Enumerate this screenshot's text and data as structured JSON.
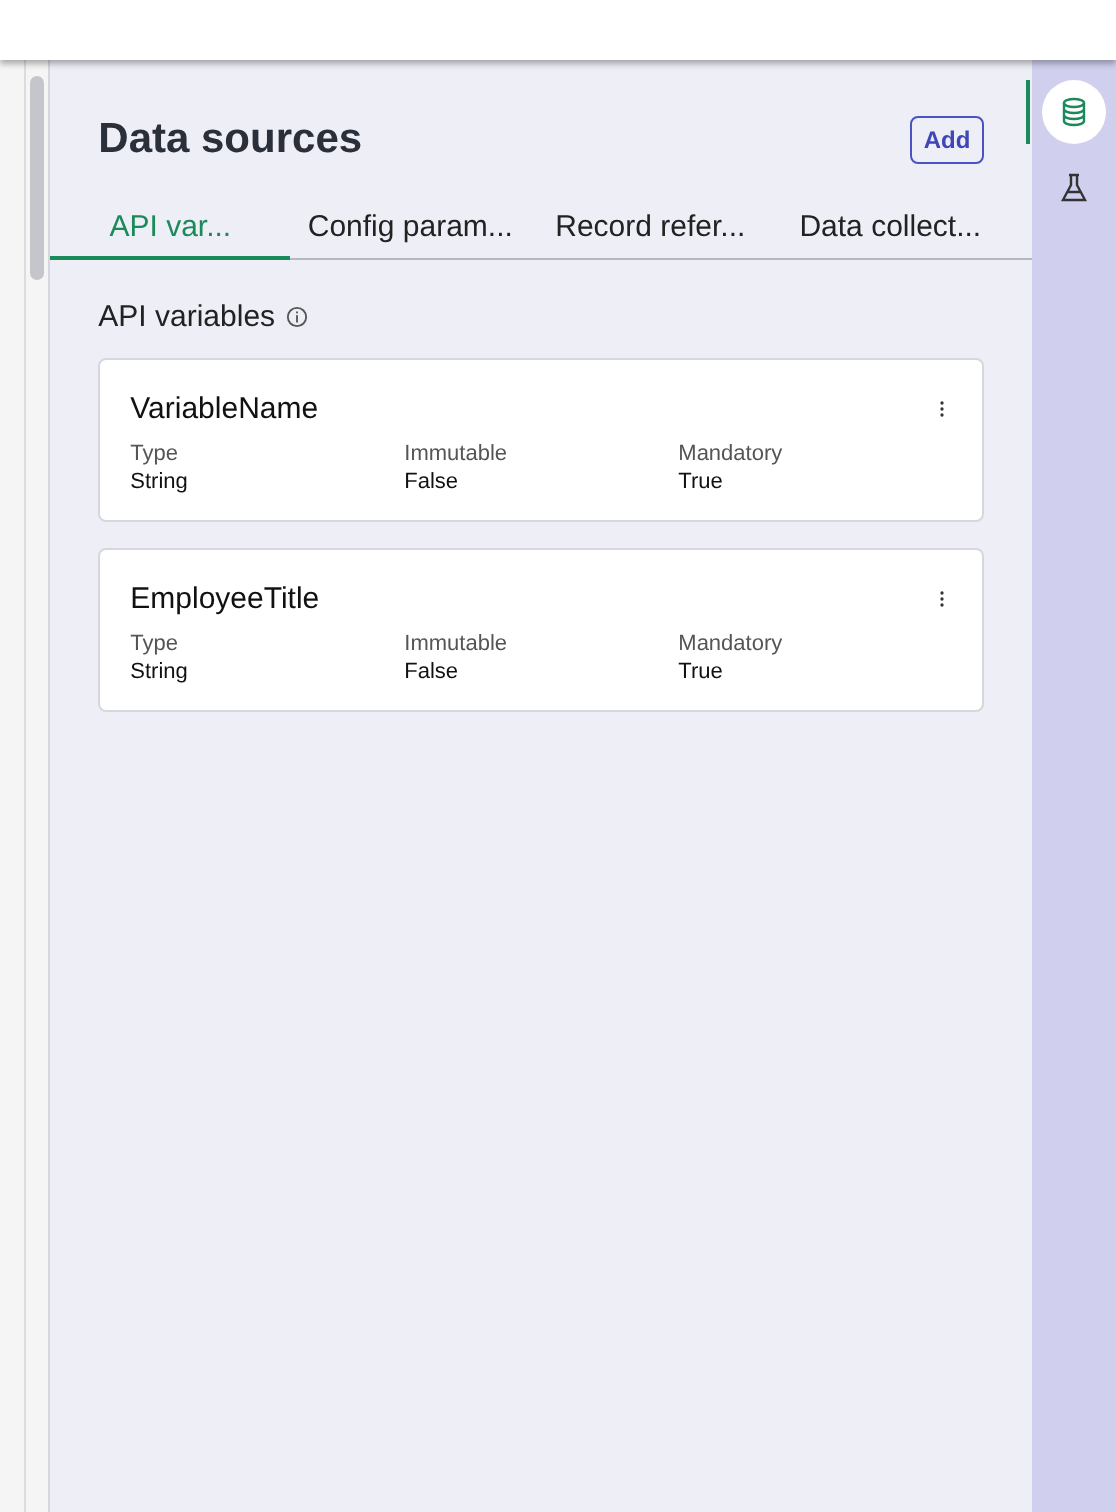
{
  "panel": {
    "title": "Data sources",
    "add_button": "Add"
  },
  "tabs": [
    {
      "label": "API var...",
      "selected": true
    },
    {
      "label": "Config param...",
      "selected": false
    },
    {
      "label": "Record refer...",
      "selected": false
    },
    {
      "label": "Data collect...",
      "selected": false
    }
  ],
  "section": {
    "title": "API variables"
  },
  "variables": [
    {
      "name": "VariableName",
      "fields": [
        {
          "label": "Type",
          "value": "String"
        },
        {
          "label": "Immutable",
          "value": "False"
        },
        {
          "label": "Mandatory",
          "value": "True"
        }
      ]
    },
    {
      "name": "EmployeeTitle",
      "fields": [
        {
          "label": "Type",
          "value": "String"
        },
        {
          "label": "Immutable",
          "value": "False"
        },
        {
          "label": "Mandatory",
          "value": "True"
        }
      ]
    }
  ],
  "rail": [
    {
      "kind": "database",
      "selected": true
    },
    {
      "kind": "flask",
      "selected": false
    }
  ]
}
